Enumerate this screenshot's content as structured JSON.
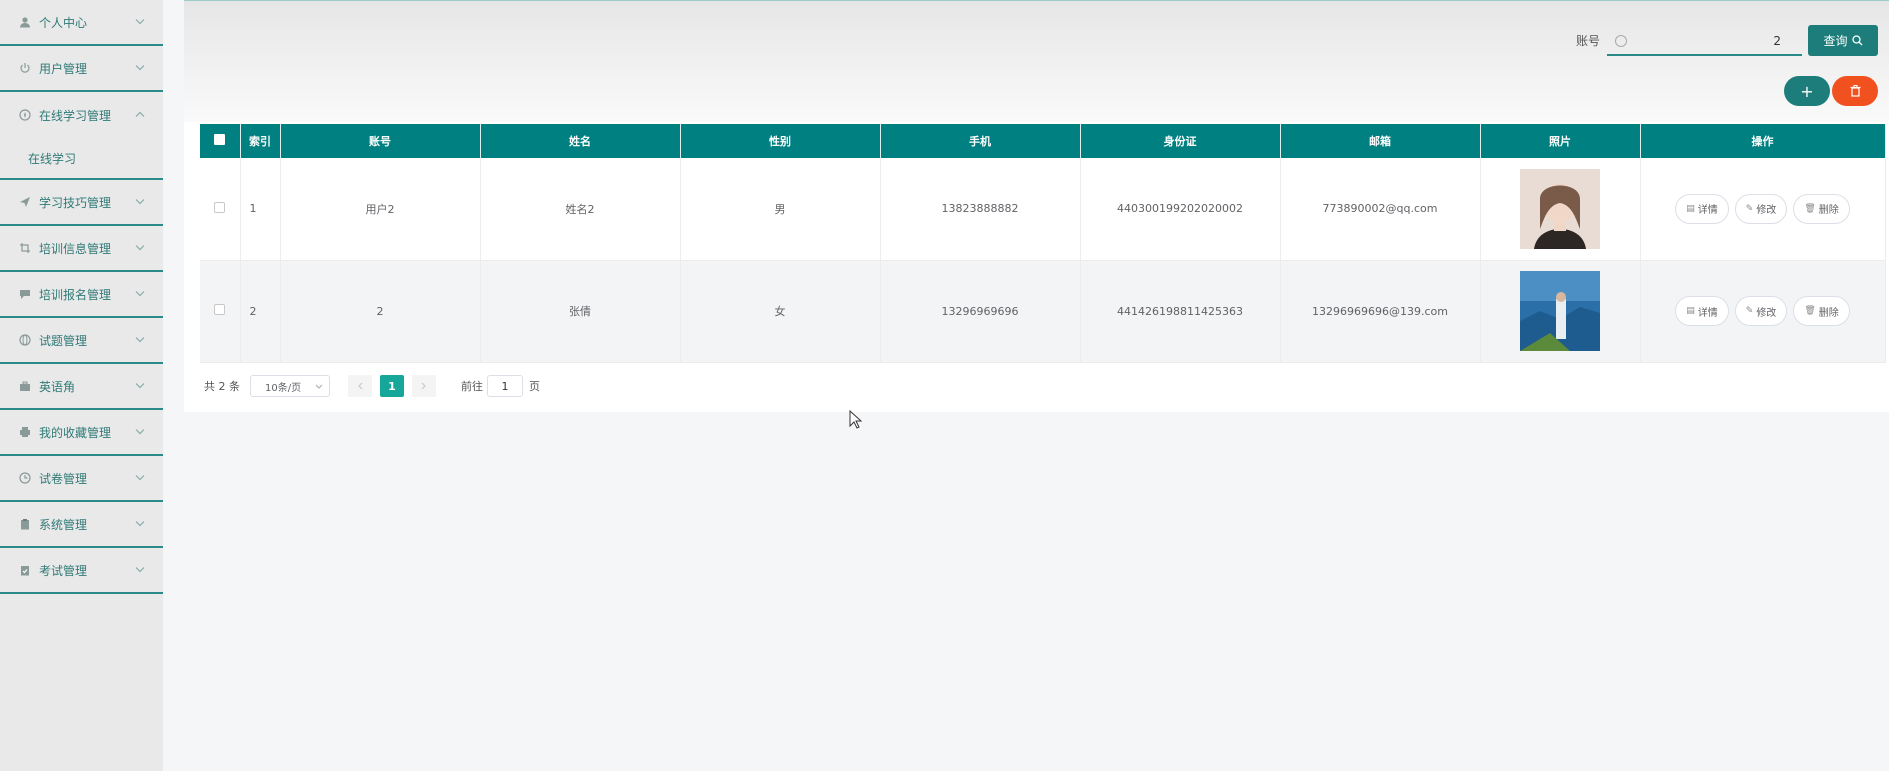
{
  "sidebar": {
    "items": [
      {
        "label": "个人中心",
        "icon": "user-icon"
      },
      {
        "label": "用户管理",
        "icon": "power-icon"
      },
      {
        "label": "在线学习管理",
        "icon": "compass-icon"
      },
      {
        "label": "学习技巧管理",
        "icon": "send-icon"
      },
      {
        "label": "培训信息管理",
        "icon": "crop-icon"
      },
      {
        "label": "培训报名管理",
        "icon": "chat-icon"
      },
      {
        "label": "试题管理",
        "icon": "globe-icon"
      },
      {
        "label": "英语角",
        "icon": "briefcase-icon"
      },
      {
        "label": "我的收藏管理",
        "icon": "printer-icon"
      },
      {
        "label": "试卷管理",
        "icon": "clock-icon"
      },
      {
        "label": "系统管理",
        "icon": "clipboard-icon"
      },
      {
        "label": "考试管理",
        "icon": "clipboard-check-icon"
      }
    ],
    "submenu": {
      "label": "在线学习"
    }
  },
  "search": {
    "label": "账号",
    "value": "2",
    "button": "查询"
  },
  "toolbar": {
    "add": "+",
    "delete": "🗑"
  },
  "table": {
    "headers": [
      "索引",
      "账号",
      "姓名",
      "性别",
      "手机",
      "身份证",
      "邮箱",
      "照片",
      "操作"
    ],
    "rows": [
      {
        "index": "1",
        "account": "用户2",
        "name": "姓名2",
        "gender": "男",
        "phone": "13823888882",
        "idcard": "440300199202020002",
        "email": "773890002@qq.com"
      },
      {
        "index": "2",
        "account": "2",
        "name": "张倩",
        "gender": "女",
        "phone": "13296969696",
        "idcard": "441426198811425363",
        "email": "13296969696@139.com"
      }
    ],
    "ops": {
      "detail": "详情",
      "edit": "修改",
      "delete": "删除"
    }
  },
  "pagination": {
    "total": "共 2 条",
    "page_size": "10条/页",
    "current": "1",
    "goto_label": "前往",
    "goto_value": "1",
    "page_suffix": "页"
  },
  "colors": {
    "primary": "#008080",
    "danger": "#f0511e",
    "sidebar_bg": "#e9e9e9"
  }
}
